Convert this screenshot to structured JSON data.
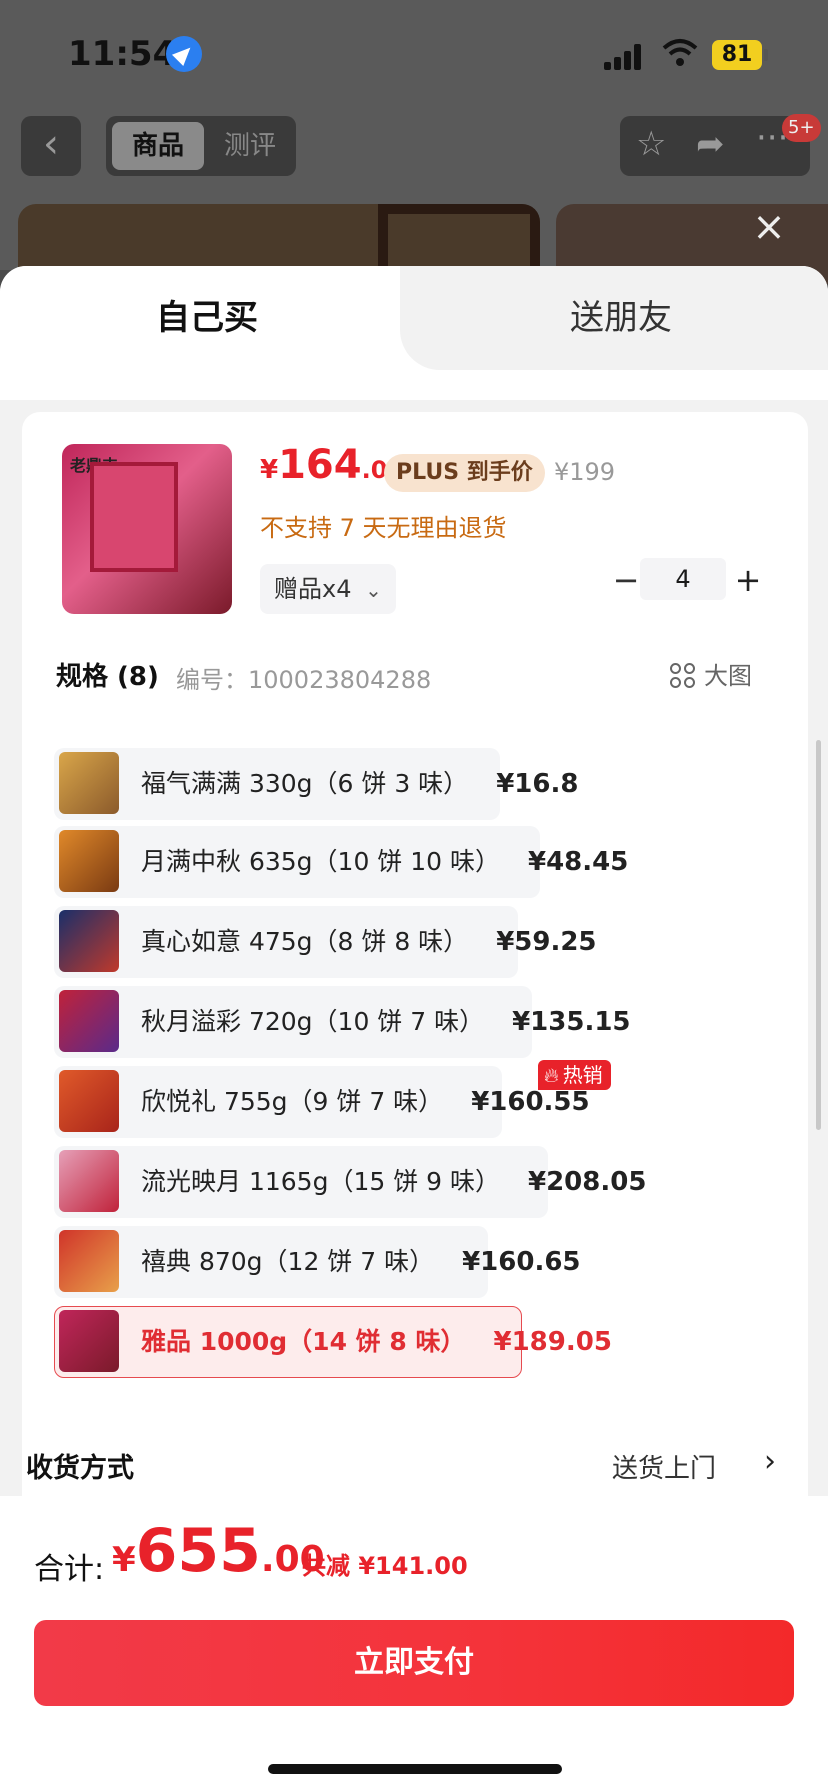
{
  "status_bar": {
    "time": "11:54",
    "battery": "81"
  },
  "top_nav": {
    "back_icon": "chevron-left-icon",
    "segments": [
      {
        "label": "商品",
        "active": true
      },
      {
        "label": "测评",
        "active": false
      }
    ],
    "icons": [
      "star-icon",
      "share-icon",
      "more-icon"
    ],
    "badge": "5+"
  },
  "sheet": {
    "tabs": [
      {
        "label": "自己买",
        "active": true
      },
      {
        "label": "送朋友",
        "active": false
      }
    ]
  },
  "product": {
    "price_symbol": "¥",
    "price_int": "164",
    "price_dec": ".05",
    "plus_tag": "PLUS 到手价",
    "original_price": "¥199",
    "return_policy": "不支持 7 天无理由退货",
    "gift_label": "赠品x4",
    "quantity": "4",
    "minus": "−",
    "plus": "+",
    "image_logo": "老鼎丰"
  },
  "spec": {
    "title": "规格 (8)",
    "sku": "编号：100023804288",
    "big_image": "大图",
    "hot_badge": "热销",
    "items": [
      {
        "name": "福气满满 330g（6 饼 3 味）",
        "price": "¥16.8"
      },
      {
        "name": "月满中秋 635g（10 饼 10 味）",
        "price": "¥48.45"
      },
      {
        "name": "真心如意 475g（8 饼 8 味）",
        "price": "¥59.25"
      },
      {
        "name": "秋月溢彩 720g（10 饼 7 味）",
        "price": "¥135.15"
      },
      {
        "name": "欣悦礼 755g（9 饼 7 味）",
        "price": "¥160.55"
      },
      {
        "name": "流光映月 1165g（15 饼 9 味）",
        "price": "¥208.05"
      },
      {
        "name": "禧典 870g（12 饼 7 味）",
        "price": "¥160.65"
      },
      {
        "name": "雅品 1000g（14 饼 8 味）",
        "price": "¥189.05"
      }
    ]
  },
  "shipping": {
    "title": "收货方式",
    "value": "送货上门"
  },
  "footer": {
    "total_label": "合计:",
    "total_symbol": "¥",
    "total_int": "655",
    "total_dec": ".00",
    "discount": "共减 ¥141.00",
    "pay_button": "立即支付"
  },
  "colors": {
    "accent": "#e8222a",
    "orange_text": "#c86a12",
    "plus_tag_bg": "#f8e3cf"
  }
}
